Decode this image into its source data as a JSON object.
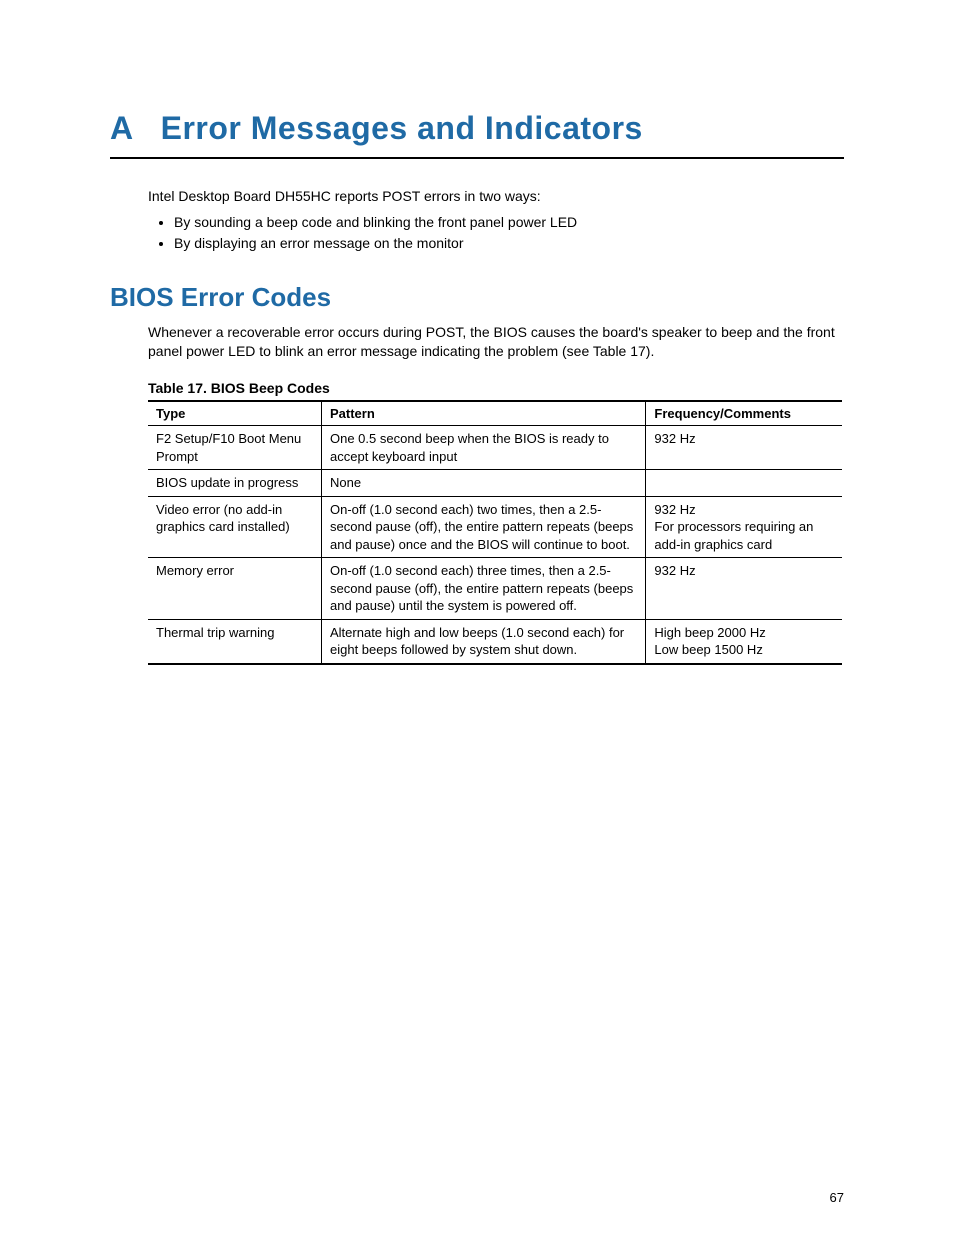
{
  "appendix_letter": "A",
  "page_title": "Error Messages and Indicators",
  "intro_text": "Intel Desktop Board DH55HC reports POST errors in two ways:",
  "bullets": [
    "By sounding a beep code and blinking the front panel power LED",
    "By displaying an error message on the monitor"
  ],
  "section_heading": "BIOS Error Codes",
  "section_para": "Whenever a recoverable error occurs during POST, the BIOS causes the board's speaker to beep and the front panel power LED to blink an error message indicating the problem (see Table 17).",
  "table_caption": "Table 17. BIOS Beep Codes",
  "table_headers": {
    "type": "Type",
    "pattern": "Pattern",
    "freq": "Frequency/Comments"
  },
  "rows": [
    {
      "type": "F2 Setup/F10 Boot Menu Prompt",
      "pattern": "One 0.5 second beep when the BIOS is ready to accept keyboard input",
      "freq_a": "932 Hz",
      "freq_b": ""
    },
    {
      "type": "BIOS update in progress",
      "pattern": "None",
      "freq_a": "",
      "freq_b": ""
    },
    {
      "type": "Video error (no add-in graphics card installed)",
      "pattern": "On-off (1.0 second each) two times, then a 2.5-second pause (off), the entire pattern repeats (beeps and pause) once and the BIOS will continue to boot.",
      "freq_a": "932 Hz",
      "freq_b": "For processors requiring an add-in graphics card"
    },
    {
      "type": "Memory error",
      "pattern": "On-off (1.0 second each) three times, then a 2.5-second pause (off), the entire pattern repeats (beeps and pause) until the system is powered off.",
      "freq_a": "932 Hz",
      "freq_b": ""
    },
    {
      "type": "Thermal trip warning",
      "pattern": "Alternate high and low beeps (1.0 second each) for eight beeps followed by system shut down.",
      "freq_a": "High beep 2000 Hz",
      "freq_b": "Low beep 1500 Hz"
    }
  ],
  "page_number": "67"
}
